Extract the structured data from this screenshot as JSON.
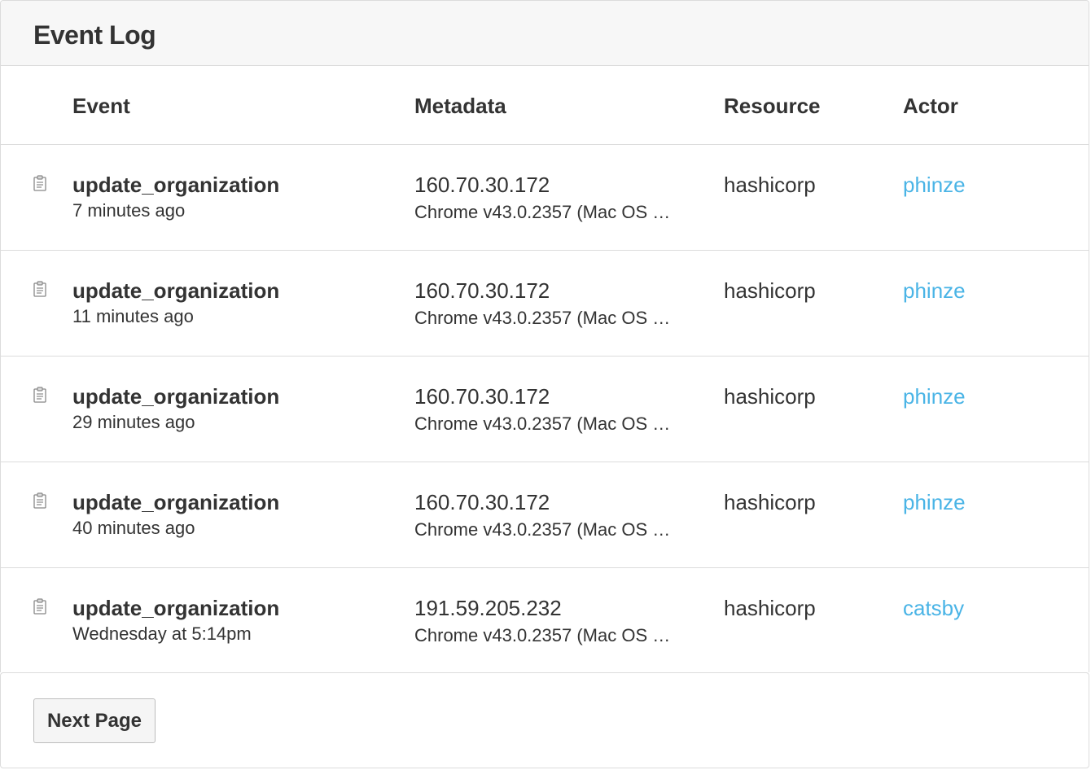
{
  "panel": {
    "title": "Event Log"
  },
  "columns": {
    "event": "Event",
    "metadata": "Metadata",
    "resource": "Resource",
    "actor": "Actor"
  },
  "events": [
    {
      "name": "update_organization",
      "time": "7 minutes ago",
      "ip": "160.70.30.172",
      "user_agent": "Chrome v43.0.2357 (Mac OS …",
      "resource": "hashicorp",
      "actor": "phinze",
      "icon": "clipboard-icon"
    },
    {
      "name": "update_organization",
      "time": "11 minutes ago",
      "ip": "160.70.30.172",
      "user_agent": "Chrome v43.0.2357 (Mac OS …",
      "resource": "hashicorp",
      "actor": "phinze",
      "icon": "clipboard-icon"
    },
    {
      "name": "update_organization",
      "time": "29 minutes ago",
      "ip": "160.70.30.172",
      "user_agent": "Chrome v43.0.2357 (Mac OS …",
      "resource": "hashicorp",
      "actor": "phinze",
      "icon": "clipboard-icon"
    },
    {
      "name": "update_organization",
      "time": "40 minutes ago",
      "ip": "160.70.30.172",
      "user_agent": "Chrome v43.0.2357 (Mac OS …",
      "resource": "hashicorp",
      "actor": "phinze",
      "icon": "clipboard-icon"
    },
    {
      "name": "update_organization",
      "time": "Wednesday at 5:14pm",
      "ip": "191.59.205.232",
      "user_agent": "Chrome v43.0.2357 (Mac OS …",
      "resource": "hashicorp",
      "actor": "catsby",
      "icon": "clipboard-icon"
    }
  ],
  "pagination": {
    "next_label": "Next Page"
  },
  "colors": {
    "link": "#4ab4e6",
    "border": "#dcdcdc",
    "header_bg": "#f7f7f7",
    "text": "#333333"
  }
}
